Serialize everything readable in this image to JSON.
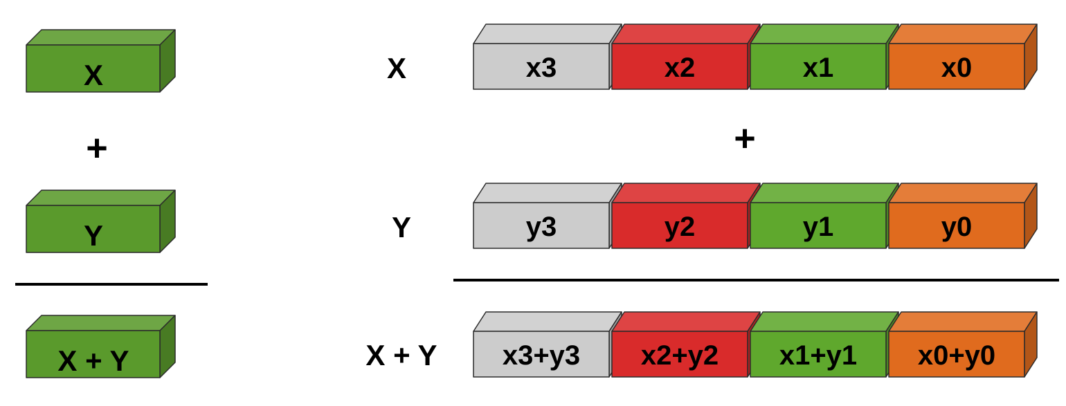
{
  "scalar": {
    "operand_x": "X",
    "operator": "+",
    "operand_y": "Y",
    "result": "X + Y"
  },
  "vector": {
    "row_x_label": "X",
    "operator": "+",
    "row_y_label": "Y",
    "row_result_label": "X + Y",
    "x_lanes": [
      "x3",
      "x2",
      "x1",
      "x0"
    ],
    "y_lanes": [
      "y3",
      "y2",
      "y1",
      "y0"
    ],
    "sum_lanes": [
      "x3+y3",
      "x2+y2",
      "x1+y1",
      "x0+y0"
    ]
  },
  "colors": {
    "scalar_green": "#5a9a2c",
    "lane_gray": "#cccccc",
    "lane_red": "#d92b2b",
    "lane_green": "#5fa82d",
    "lane_orange": "#e06b1e",
    "rule": "#000000",
    "text": "#000000"
  }
}
